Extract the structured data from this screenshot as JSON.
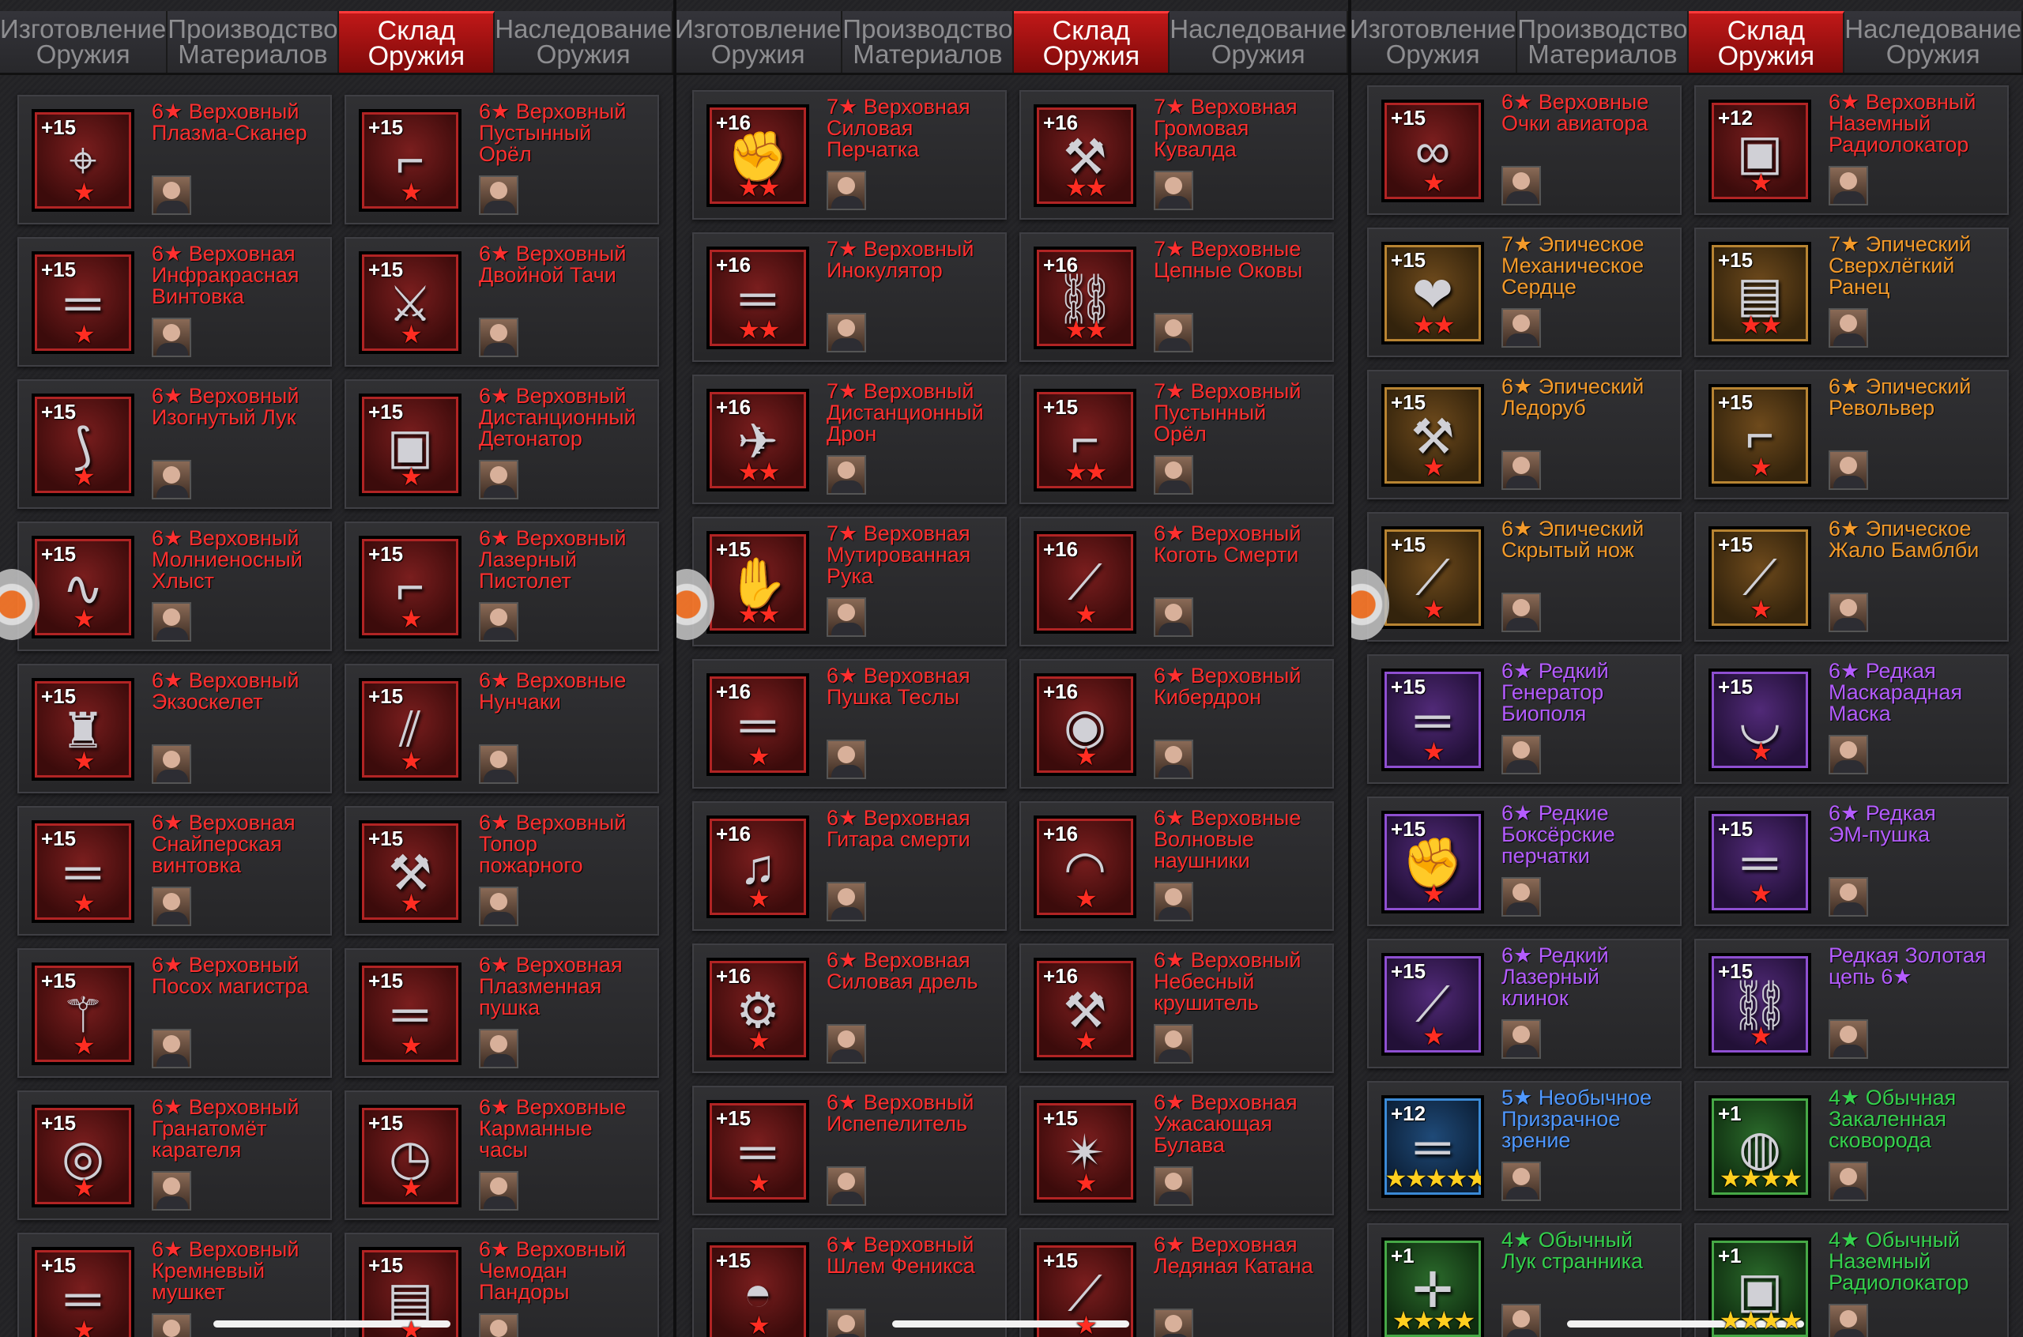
{
  "tabs": [
    "Изготовление\nОружия",
    "Производство\nМатериалов",
    "Склад Оружия",
    "Наследование\nОружия"
  ],
  "active_tab_index": 2,
  "colors": {
    "supreme": "#ff2f2f",
    "epic": "#f39a2a",
    "rare": "#b45cff",
    "uncommon": "#4f98ff",
    "common": "#35d04d"
  },
  "panels": [
    {
      "items": [
        {
          "level": "+15",
          "name": "6★ Верховный\nПлазма-Сканер",
          "rarity": "supreme",
          "stars": "★",
          "icon": "scanner-icon",
          "glyph": "⌖"
        },
        {
          "level": "+15",
          "name": "6★ Верховный\nПустынный\nОрёл",
          "rarity": "supreme",
          "stars": "★",
          "icon": "pistol-icon",
          "glyph": "⌐"
        },
        {
          "level": "+15",
          "name": "6★ Верховная\nИнфракрасная\nВинтовка",
          "rarity": "supreme",
          "stars": "★",
          "icon": "rifle-icon",
          "glyph": "═"
        },
        {
          "level": "+15",
          "name": "6★ Верховный\nДвойной Тачи",
          "rarity": "supreme",
          "stars": "★",
          "icon": "sword-icon",
          "glyph": "⚔"
        },
        {
          "level": "+15",
          "name": "6★ Верховный\nИзогнутый Лук",
          "rarity": "supreme",
          "stars": "★",
          "icon": "bow-icon",
          "glyph": "⟆"
        },
        {
          "level": "+15",
          "name": "6★ Верховный\nДистанционный\nДетонатор",
          "rarity": "supreme",
          "stars": "★",
          "icon": "detonator-icon",
          "glyph": "▣"
        },
        {
          "level": "+15",
          "name": "6★ Верховный\nМолниеносный\nХлыст",
          "rarity": "supreme",
          "stars": "★",
          "icon": "whip-icon",
          "glyph": "∿"
        },
        {
          "level": "+15",
          "name": "6★ Верховный\nЛазерный\nПистолет",
          "rarity": "supreme",
          "stars": "★",
          "icon": "laser-pistol-icon",
          "glyph": "⌐"
        },
        {
          "level": "+15",
          "name": "6★ Верховный\nЭкзоскелет",
          "rarity": "supreme",
          "stars": "★",
          "icon": "exoskeleton-icon",
          "glyph": "♜"
        },
        {
          "level": "+15",
          "name": "6★ Верховные\nНунчаки",
          "rarity": "supreme",
          "stars": "★",
          "icon": "nunchaku-icon",
          "glyph": "⫽"
        },
        {
          "level": "+15",
          "name": "6★ Верховная\nСнайперская\nвинтовка",
          "rarity": "supreme",
          "stars": "★",
          "icon": "sniper-rifle-icon",
          "glyph": "═"
        },
        {
          "level": "+15",
          "name": "6★ Верховный\nТопор\nпожарного",
          "rarity": "supreme",
          "stars": "★",
          "icon": "axe-icon",
          "glyph": "⚒"
        },
        {
          "level": "+15",
          "name": "6★ Верховный\nПосох магистра",
          "rarity": "supreme",
          "stars": "★",
          "icon": "staff-icon",
          "glyph": "⚚"
        },
        {
          "level": "+15",
          "name": "6★ Верховная\nПлазменная\nпушка",
          "rarity": "supreme",
          "stars": "★",
          "icon": "plasma-cannon-icon",
          "glyph": "═"
        },
        {
          "level": "+15",
          "name": "6★ Верховный\nГранатомёт\nкарателя",
          "rarity": "supreme",
          "stars": "★",
          "icon": "grenade-launcher-icon",
          "glyph": "◎"
        },
        {
          "level": "+15",
          "name": "6★ Верховные\nКарманные\nчасы",
          "rarity": "supreme",
          "stars": "★",
          "icon": "pocket-watch-icon",
          "glyph": "◷"
        },
        {
          "level": "+15",
          "name": "6★ Верховный\nКремневый\nмушкет",
          "rarity": "supreme",
          "stars": "★",
          "icon": "musket-icon",
          "glyph": "═"
        },
        {
          "level": "+15",
          "name": "6★ Верховный\nЧемодан\nПандоры",
          "rarity": "supreme",
          "stars": "★",
          "icon": "suitcase-icon",
          "glyph": "▤"
        }
      ]
    },
    {
      "items": [
        {
          "level": "+16",
          "name": "7★ Верховная\nСиловая\nПерчатка",
          "rarity": "supreme",
          "stars": "★★",
          "icon": "gauntlet-icon",
          "glyph": "✊"
        },
        {
          "level": "+16",
          "name": "7★ Верховная\nГромовая\nКувалда",
          "rarity": "supreme",
          "stars": "★★",
          "icon": "hammer-icon",
          "glyph": "⚒"
        },
        {
          "level": "+16",
          "name": "7★ Верховный\nИнокулятор",
          "rarity": "supreme",
          "stars": "★★",
          "icon": "inoculator-icon",
          "glyph": "═"
        },
        {
          "level": "+16",
          "name": "7★ Верховные\nЦепные Оковы",
          "rarity": "supreme",
          "stars": "★★",
          "icon": "chains-icon",
          "glyph": "⛓"
        },
        {
          "level": "+16",
          "name": "7★ Верховный\nДистанционный\nДрон",
          "rarity": "supreme",
          "stars": "★★",
          "icon": "drone-icon",
          "glyph": "✈"
        },
        {
          "level": "+15",
          "name": "7★ Верховный\nПустынный\nОрёл",
          "rarity": "supreme",
          "stars": "★★",
          "icon": "pistol-icon",
          "glyph": "⌐"
        },
        {
          "level": "+15",
          "name": "7★ Верховная\nМутированная\nРука",
          "rarity": "supreme",
          "stars": "★★",
          "icon": "mutated-arm-icon",
          "glyph": "✋"
        },
        {
          "level": "+16",
          "name": "6★ Верховный\nКоготь Смерти",
          "rarity": "supreme",
          "stars": "★",
          "icon": "claw-icon",
          "glyph": "⟋"
        },
        {
          "level": "+16",
          "name": "6★ Верховная\nПушка Теслы",
          "rarity": "supreme",
          "stars": "★",
          "icon": "tesla-cannon-icon",
          "glyph": "═"
        },
        {
          "level": "+16",
          "name": "6★ Верховный\nКибердрон",
          "rarity": "supreme",
          "stars": "★",
          "icon": "cyber-drone-icon",
          "glyph": "◉"
        },
        {
          "level": "+16",
          "name": "6★ Верховная\nГитара смерти",
          "rarity": "supreme",
          "stars": "★",
          "icon": "guitar-icon",
          "glyph": "♫"
        },
        {
          "level": "+16",
          "name": "6★ Верховные\nВолновые\nнаушники",
          "rarity": "supreme",
          "stars": "★",
          "icon": "headphones-icon",
          "glyph": "◠"
        },
        {
          "level": "+16",
          "name": "6★ Верховная\nСиловая дрель",
          "rarity": "supreme",
          "stars": "★",
          "icon": "drill-icon",
          "glyph": "⚙"
        },
        {
          "level": "+16",
          "name": "6★ Верховный\nНебесный\nкрушитель",
          "rarity": "supreme",
          "stars": "★",
          "icon": "sky-crusher-icon",
          "glyph": "⚒"
        },
        {
          "level": "+15",
          "name": "6★ Верховный\nИспепелитель",
          "rarity": "supreme",
          "stars": "★",
          "icon": "incinerator-icon",
          "glyph": "═"
        },
        {
          "level": "+15",
          "name": "6★ Верховная\nУжасающая\nБулава",
          "rarity": "supreme",
          "stars": "★",
          "icon": "mace-icon",
          "glyph": "✴"
        },
        {
          "level": "+15",
          "name": "6★ Верховный\nШлем Феникса",
          "rarity": "supreme",
          "stars": "★",
          "icon": "helmet-icon",
          "glyph": "◓"
        },
        {
          "level": "+15",
          "name": "6★ Верховная\nЛедяная Катана",
          "rarity": "supreme",
          "stars": "★",
          "icon": "katana-icon",
          "glyph": "⟋"
        }
      ]
    },
    {
      "items": [
        {
          "level": "+15",
          "name": "6★ Верховные\nОчки авиатора",
          "rarity": "supreme",
          "stars": "★",
          "icon": "goggles-icon",
          "glyph": "∞"
        },
        {
          "level": "+12",
          "name": "6★ Верховный\nНаземный\nРадиолокатор",
          "rarity": "supreme",
          "stars": "★",
          "icon": "radar-icon",
          "glyph": "▣"
        },
        {
          "level": "+15",
          "name": "7★ Эпическое\nМеханическое\nСердце",
          "rarity": "epic",
          "stars": "★★",
          "icon": "mech-heart-icon",
          "glyph": "❤"
        },
        {
          "level": "+15",
          "name": "7★ Эпический\nСверхлёгкий\nРанец",
          "rarity": "epic",
          "stars": "★★",
          "icon": "backpack-icon",
          "glyph": "▤"
        },
        {
          "level": "+15",
          "name": "6★ Эпический\nЛедоруб",
          "rarity": "epic",
          "stars": "★",
          "icon": "ice-axe-icon",
          "glyph": "⚒"
        },
        {
          "level": "+15",
          "name": "6★ Эпический\nРевольвер",
          "rarity": "epic",
          "stars": "★",
          "icon": "revolver-icon",
          "glyph": "⌐"
        },
        {
          "level": "+15",
          "name": "6★ Эпический\nСкрытый нож",
          "rarity": "epic",
          "stars": "★",
          "icon": "knife-icon",
          "glyph": "⟋"
        },
        {
          "level": "+15",
          "name": "6★ Эпическое\nЖало Бамблби",
          "rarity": "epic",
          "stars": "★",
          "icon": "stinger-icon",
          "glyph": "⟋"
        },
        {
          "level": "+15",
          "name": "6★ Редкий\nГенератор\nБиополя",
          "rarity": "rare",
          "stars": "★",
          "icon": "bio-generator-icon",
          "glyph": "═"
        },
        {
          "level": "+15",
          "name": "6★ Редкая\nМаскарадная\nМаска",
          "rarity": "rare",
          "stars": "★",
          "icon": "mask-icon",
          "glyph": "◡"
        },
        {
          "level": "+15",
          "name": "6★ Редкие\nБоксёрские\nперчатки",
          "rarity": "rare",
          "stars": "★",
          "icon": "boxing-gloves-icon",
          "glyph": "✊"
        },
        {
          "level": "+15",
          "name": "6★ Редкая\nЭМ-пушка",
          "rarity": "rare",
          "stars": "★",
          "icon": "em-cannon-icon",
          "glyph": "═"
        },
        {
          "level": "+15",
          "name": "6★ Редкий\nЛазерный\nклинок",
          "rarity": "rare",
          "stars": "★",
          "icon": "laser-blade-icon",
          "glyph": "⟋"
        },
        {
          "level": "+15",
          "name": "Редкая Золотая\nцепь 6★",
          "rarity": "rare",
          "stars": "★",
          "icon": "gold-chain-icon",
          "glyph": "⛓"
        },
        {
          "level": "+12",
          "name": "5★ Необычное\nПризрачное\nзрение",
          "rarity": "uncommon",
          "stars": "★★★★★",
          "icon": "ghost-vision-icon",
          "glyph": "═",
          "gold": true
        },
        {
          "level": "+1",
          "name": "4★ Обычная\nЗакаленная\nсковорода",
          "rarity": "common",
          "stars": "★★★★",
          "icon": "frying-pan-icon",
          "glyph": "◍",
          "gold": true
        },
        {
          "level": "+1",
          "name": "4★ Обычный\nЛук странника",
          "rarity": "common",
          "stars": "★★★★",
          "icon": "crossbow-icon",
          "glyph": "✛",
          "gold": true
        },
        {
          "level": "+1",
          "name": "4★ Обычный\nНаземный\nРадиолокатор",
          "rarity": "common",
          "stars": "★★★★",
          "icon": "radar-icon",
          "glyph": "▣",
          "gold": true
        }
      ]
    }
  ]
}
